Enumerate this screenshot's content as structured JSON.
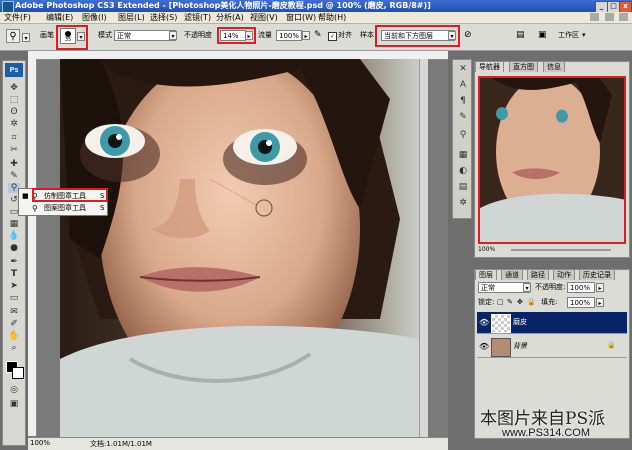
{
  "window": {
    "title": "Adobe Photoshop CS3 Extended - [Photoshop美化人物照片-磨皮教程.psd @ 100% (磨皮, RGB/8#)]",
    "buttons": [
      "_",
      "□",
      "x"
    ]
  },
  "menu": [
    "文件(F)",
    "编辑(E)",
    "图像(I)",
    "图层(L)",
    "选择(S)",
    "滤镜(T)",
    "分析(A)",
    "视图(V)",
    "窗口(W)",
    "帮助(H)"
  ],
  "options": {
    "brush_label": "画笔",
    "brush_size": "35",
    "mode_label": "模式",
    "mode_value": "正常",
    "opacity_label": "不透明度",
    "opacity_value": "14%",
    "flow_label": "流量",
    "flow_value": "100%",
    "align_label": "对齐",
    "sample_label": "样本",
    "sample_value": "当前和下方图层",
    "workspace_label": "工作区"
  },
  "tool_flyout": {
    "items": [
      {
        "label": "仿制图章工具",
        "shortcut": "S"
      },
      {
        "label": "图案图章工具",
        "shortcut": "S"
      }
    ]
  },
  "status": {
    "zoom": "100%",
    "doc": "文档:1.01M/1.01M"
  },
  "navigator": {
    "tabs": [
      "导航器",
      "直方图",
      "信息"
    ],
    "zoom": "100%"
  },
  "layers": {
    "tabs": [
      "图层",
      "通道",
      "路径",
      "动作",
      "历史记录"
    ],
    "blend_mode": "正常",
    "opacity_label": "不透明度:",
    "opacity_value": "100%",
    "lock_label": "锁定:",
    "fill_label": "填充:",
    "fill_value": "100%",
    "items": [
      {
        "name": "磨皮",
        "selected": true
      },
      {
        "name": "背景",
        "selected": false,
        "locked": true
      }
    ]
  },
  "watermark": {
    "line1": "本图片来自PS派",
    "line2": "www.PS314.COM"
  },
  "colors": {
    "highlight_red": "#e11b22",
    "selected_layer": "#0a246a",
    "ps_blue": "#1c5da8"
  }
}
